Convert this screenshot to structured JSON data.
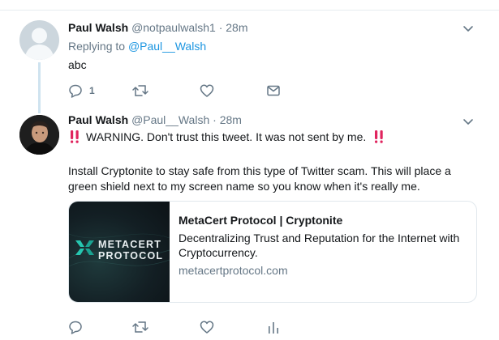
{
  "tweets": [
    {
      "name": "Paul Walsh",
      "handle": "@notpaulwalsh1",
      "time": "28m",
      "reply_prefix": "Replying to",
      "reply_mention": "@Paul__Walsh",
      "text": "abc",
      "reply_count": "1",
      "avatar_icon": "default-avatar-icon"
    },
    {
      "name": "Paul Walsh",
      "handle": "@Paul__Walsh",
      "time": "28m",
      "warning": "WARNING. Don't trust this tweet. It was not sent by me.",
      "body_line1": "Install Cryptonite to stay safe from this type of Twitter scam. This will place a",
      "body_line2": "green shield next to my screen name so you know when it's really me.",
      "card": {
        "title": "MetaCert Protocol | Cryptonite",
        "description": "Decentralizing Trust and Reputation for the Internet with Cryptocurrency.",
        "url": "metacertprotocol.com",
        "logo_line1": "METACERT",
        "logo_line2": "PROTOCOL"
      }
    }
  ],
  "separator": "·",
  "colors": {
    "link": "#1b95e0",
    "muted": "#657786",
    "warning_red": "#e0245e",
    "thread_line": "#cfe3ef"
  },
  "icons": [
    "reply-icon",
    "retweet-icon",
    "like-icon",
    "dm-icon",
    "analytics-icon",
    "chevron-down-icon",
    "double-exclamation-icon"
  ]
}
